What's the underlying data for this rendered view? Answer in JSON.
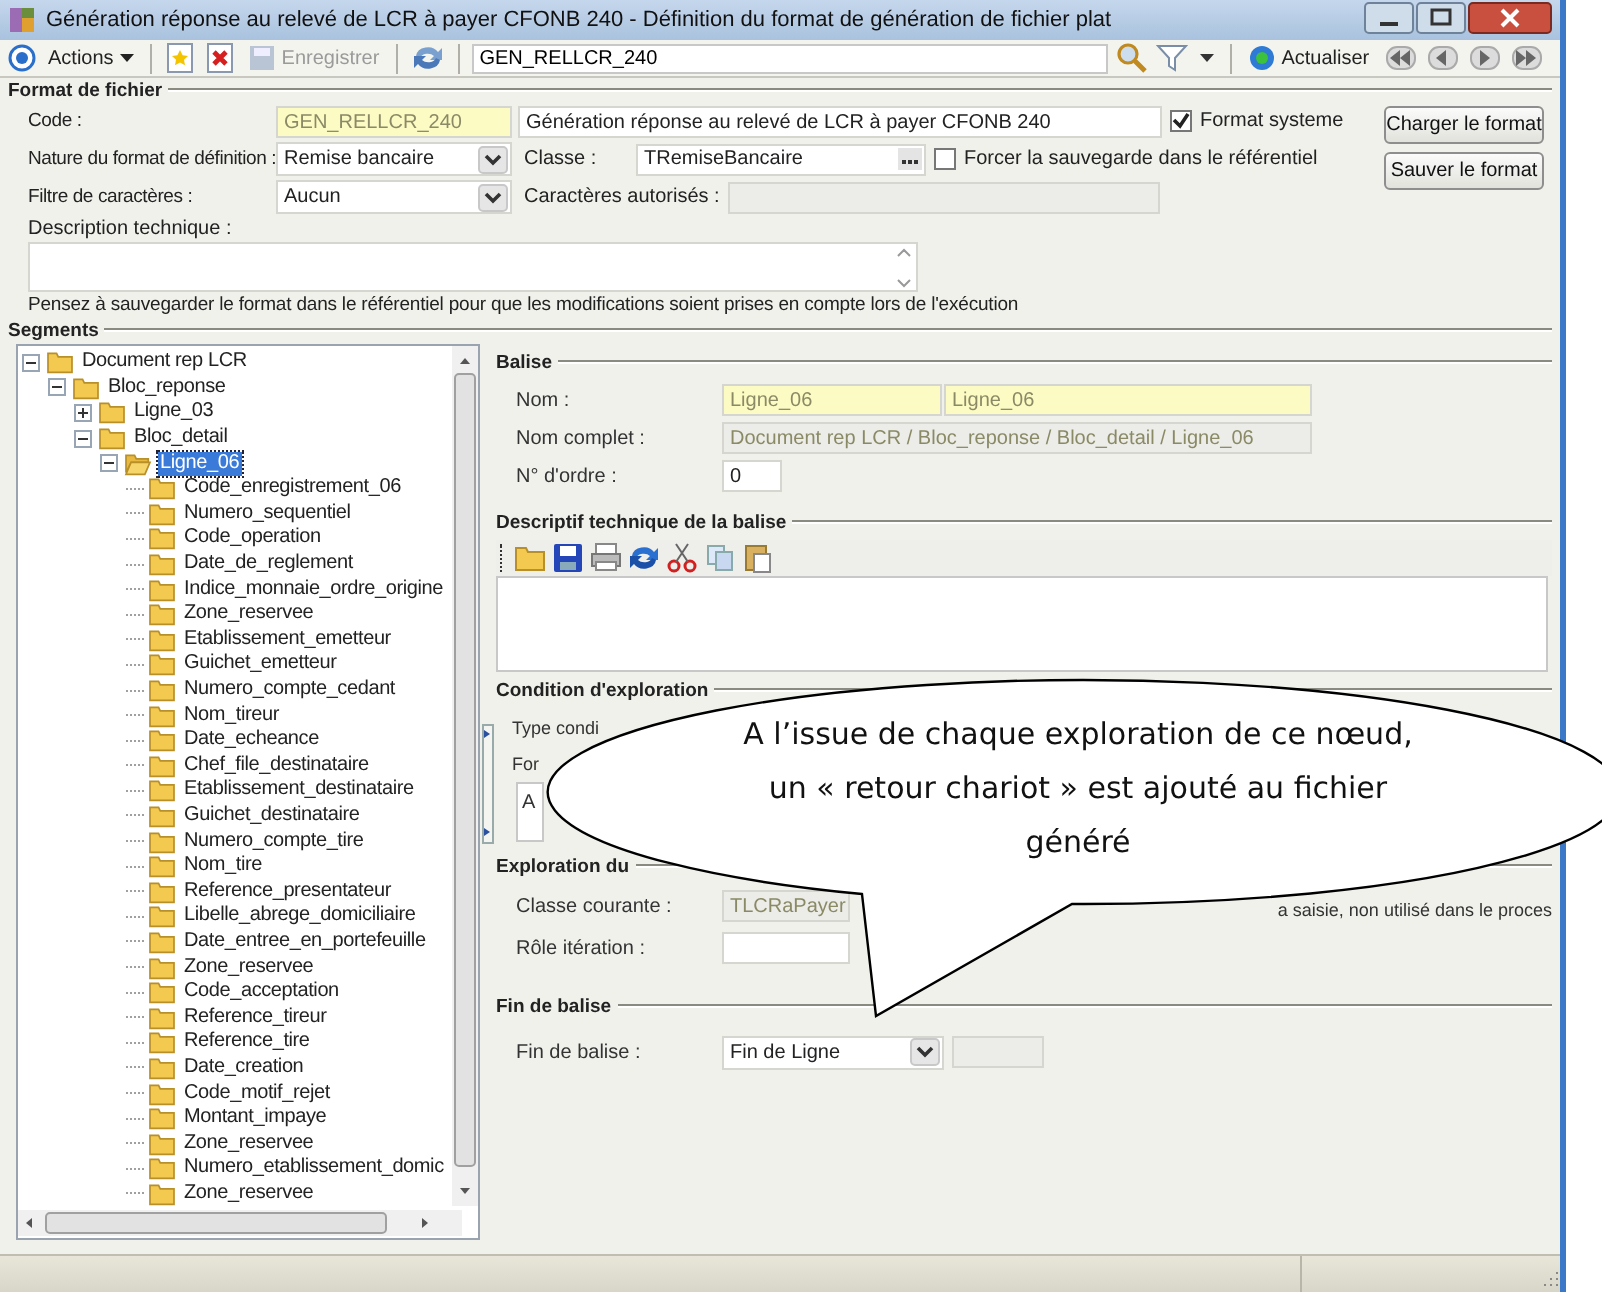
{
  "window": {
    "title": "Génération réponse au relevé de LCR à payer CFONB 240 -  Définition du format de génération de fichier plat"
  },
  "toolbar": {
    "actions": "Actions",
    "save": {
      "label": "Enregistrer",
      "disabled": true
    },
    "search_value": "GEN_RELLCR_240",
    "refresh": "Actualiser"
  },
  "format": {
    "title": "Format de fichier",
    "code_label": "Code :",
    "code": "GEN_RELLCR_240",
    "description": "Génération réponse au relevé de LCR à payer CFONB 240",
    "system_format": {
      "label": "Format systeme",
      "checked": true
    },
    "nature_label": "Nature du format de définition :",
    "nature": "Remise bancaire",
    "classe_label": "Classe :",
    "classe": "TRemiseBancaire",
    "force_save": {
      "label": "Forcer la sauvegarde dans le référentiel",
      "checked": false
    },
    "filter_label": "Filtre de caractères :",
    "filter": "Aucun",
    "allowed_label": "Caractères autorisés :",
    "desc_label": "Description technique :",
    "note": "Pensez à sauvegarder le format dans le référentiel pour que les modifications soient prises en compte lors de l'exécution",
    "buttons": [
      "Charger le format",
      "Sauver le format"
    ]
  },
  "segments": {
    "title": "Segments",
    "tree": [
      {
        "label": "Document rep LCR",
        "selected": false,
        "expanded": true,
        "children": [
          {
            "label": "Bloc_reponse",
            "selected": false,
            "expanded": true,
            "children": [
              {
                "label": "Ligne_03",
                "selected": false,
                "expanded": false
              },
              {
                "label": "Bloc_detail",
                "selected": false,
                "expanded": true,
                "children": [
                  {
                    "label": "Ligne_06",
                    "selected": true,
                    "expanded": true,
                    "children": [
                      {
                        "label": "Code_enregistrement_06",
                        "selected": false
                      },
                      {
                        "label": "Numero_sequentiel",
                        "selected": false
                      },
                      {
                        "label": "Code_operation",
                        "selected": false
                      },
                      {
                        "label": "Date_de_reglement",
                        "selected": false
                      },
                      {
                        "label": "Indice_monnaie_ordre_origine",
                        "selected": false
                      },
                      {
                        "label": "Zone_reservee",
                        "selected": false
                      },
                      {
                        "label": "Etablissement_emetteur",
                        "selected": false
                      },
                      {
                        "label": "Guichet_emetteur",
                        "selected": false
                      },
                      {
                        "label": "Numero_compte_cedant",
                        "selected": false
                      },
                      {
                        "label": "Nom_tireur",
                        "selected": false
                      },
                      {
                        "label": "Date_echeance",
                        "selected": false
                      },
                      {
                        "label": "Chef_file_destinataire",
                        "selected": false
                      },
                      {
                        "label": "Etablissement_destinataire",
                        "selected": false
                      },
                      {
                        "label": "Guichet_destinataire",
                        "selected": false
                      },
                      {
                        "label": "Numero_compte_tire",
                        "selected": false
                      },
                      {
                        "label": "Nom_tire",
                        "selected": false
                      },
                      {
                        "label": "Reference_presentateur",
                        "selected": false
                      },
                      {
                        "label": "Libelle_abrege_domiciliaire",
                        "selected": false
                      },
                      {
                        "label": "Date_entree_en_portefeuille",
                        "selected": false
                      },
                      {
                        "label": "Zone_reservee",
                        "selected": false
                      },
                      {
                        "label": "Code_acceptation",
                        "selected": false
                      },
                      {
                        "label": "Reference_tireur",
                        "selected": false
                      },
                      {
                        "label": "Reference_tire",
                        "selected": false
                      },
                      {
                        "label": "Date_creation",
                        "selected": false
                      },
                      {
                        "label": "Code_motif_rejet",
                        "selected": false
                      },
                      {
                        "label": "Montant_impaye",
                        "selected": false
                      },
                      {
                        "label": "Zone_reservee",
                        "selected": false
                      },
                      {
                        "label": "Numero_etablissement_domic",
                        "selected": false
                      },
                      {
                        "label": "Zone_reservee",
                        "selected": false
                      }
                    ]
                  }
                ]
              }
            ]
          }
        ]
      }
    ]
  },
  "balise": {
    "title": "Balise",
    "name_label": "Nom  :",
    "name_1": "Ligne_06",
    "name_2": "Ligne_06",
    "full_name_label": "Nom complet :",
    "full_name": "Document rep LCR  / Bloc_reponse / Bloc_detail / Ligne_06",
    "order_label": "N° d'ordre :",
    "order": "0"
  },
  "descriptif": {
    "title": "Descriptif technique de la balise"
  },
  "condition": {
    "title": "Condition d'exploration",
    "type_label": "Type condi",
    "formula_label": "For",
    "formula_text": "A"
  },
  "exploration": {
    "title": "Exploration du",
    "class_label": "Classe courante :",
    "class_value": "TLCRaPayer",
    "hint": "a saisie, non utilisé dans le proces",
    "role_label": "Rôle itération :"
  },
  "end": {
    "title": "Fin de balise",
    "label": "Fin de balise :",
    "value": "Fin de Ligne"
  },
  "callout": {
    "lines": [
      "A l’issue de chaque exploration de ce nœud,",
      "un « retour chariot » est ajouté au fichier",
      "généré"
    ]
  }
}
